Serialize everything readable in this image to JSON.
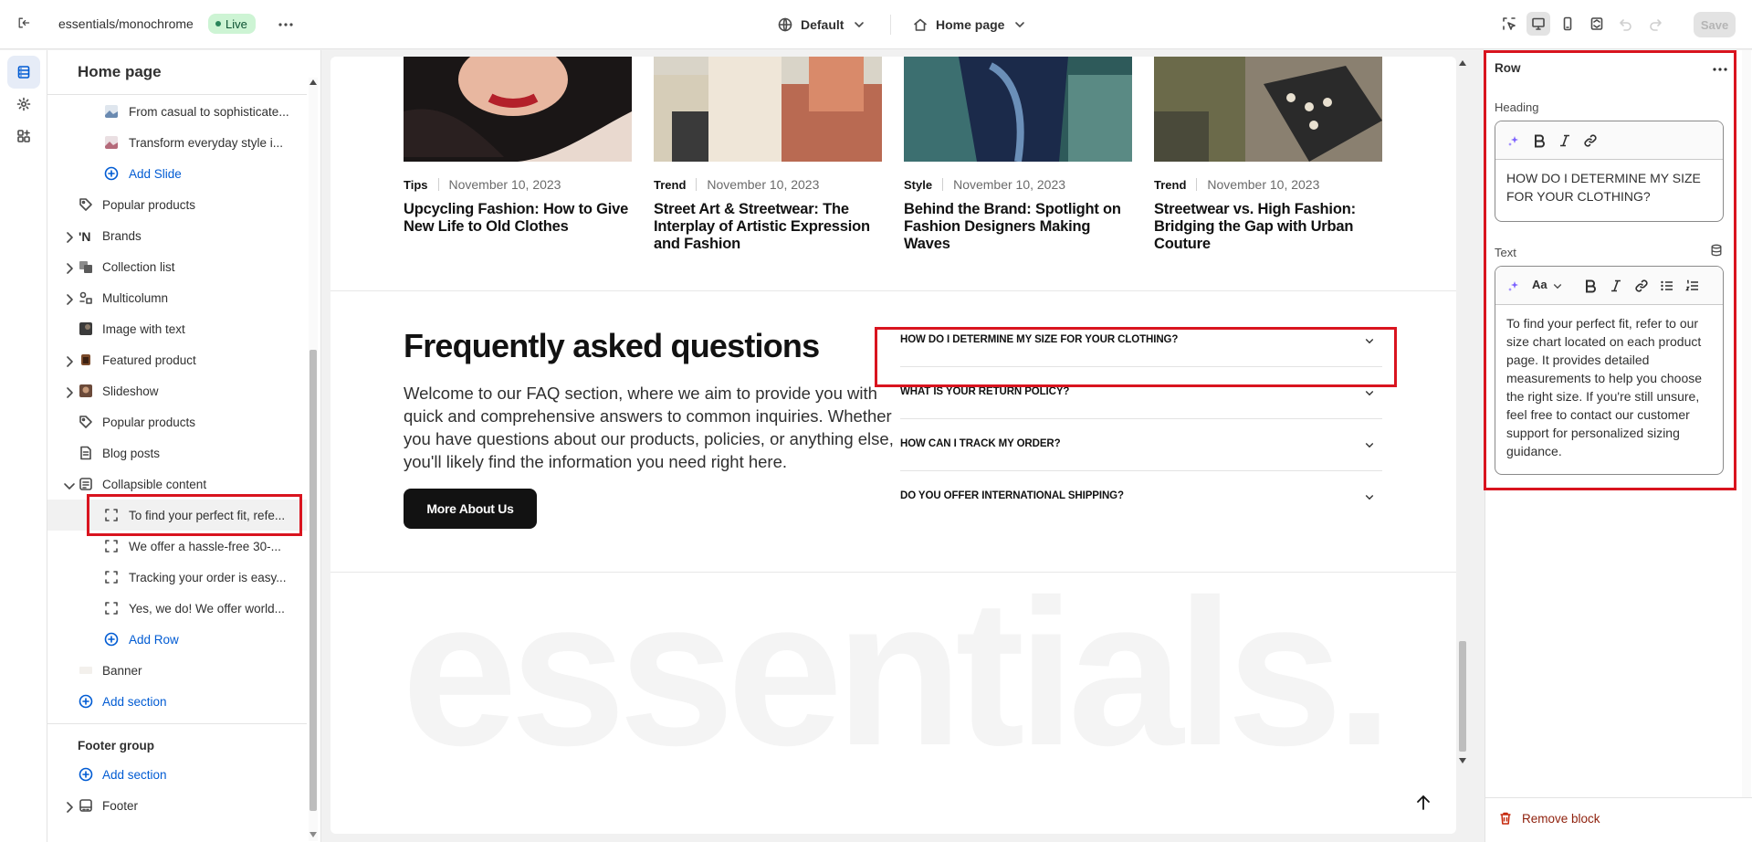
{
  "topbar": {
    "store_name": "essentials/monochrome",
    "status_badge": "Live",
    "theme_selector": "Default",
    "page_selector": "Home page",
    "save_label": "Save"
  },
  "sidebar": {
    "title": "Home page",
    "items": [
      {
        "label": "From casual to sophisticate..."
      },
      {
        "label": "Transform everyday style i..."
      },
      {
        "label": "Add Slide"
      },
      {
        "label": "Popular products"
      },
      {
        "label": "Brands"
      },
      {
        "label": "Collection list"
      },
      {
        "label": "Multicolumn"
      },
      {
        "label": "Image with text"
      },
      {
        "label": "Featured product"
      },
      {
        "label": "Slideshow"
      },
      {
        "label": "Popular products"
      },
      {
        "label": "Blog posts"
      },
      {
        "label": "Collapsible content"
      },
      {
        "label": "To find your perfect fit, refe..."
      },
      {
        "label": "We offer a hassle-free 30-..."
      },
      {
        "label": "Tracking your order is easy..."
      },
      {
        "label": "Yes, we do! We offer world..."
      },
      {
        "label": "Add Row"
      },
      {
        "label": "Banner"
      },
      {
        "label": "Add section"
      }
    ],
    "footer_group_title": "Footer group",
    "footer_add_section": "Add section",
    "footer_item": "Footer"
  },
  "preview": {
    "blog_cards": [
      {
        "tag": "Tips",
        "date": "November 10, 2023",
        "title": "Upcycling Fashion: How to Give New Life to Old Clothes"
      },
      {
        "tag": "Trend",
        "date": "November 10, 2023",
        "title": "Street Art & Streetwear: The Interplay of Artistic Expression and Fashion"
      },
      {
        "tag": "Style",
        "date": "November 10, 2023",
        "title": "Behind the Brand: Spotlight on Fashion Designers Making Waves"
      },
      {
        "tag": "Trend",
        "date": "November 10, 2023",
        "title": "Streetwear vs. High Fashion: Bridging the Gap with Urban Couture"
      }
    ],
    "faq": {
      "title": "Frequently asked questions",
      "description": "Welcome to our FAQ section, where we aim to provide you with quick and comprehensive answers to common inquiries. Whether you have questions about our products, policies, or anything else, you'll likely find the information you need right here.",
      "button": "More About Us",
      "questions": [
        "HOW DO I DETERMINE MY SIZE FOR YOUR CLOTHING?",
        "WHAT IS YOUR RETURN POLICY?",
        "HOW CAN I TRACK MY ORDER?",
        "DO YOU OFFER INTERNATIONAL SHIPPING?"
      ]
    },
    "watermark": "essentials."
  },
  "panel": {
    "title": "Row",
    "heading_label": "Heading",
    "heading_value": "HOW DO I DETERMINE MY SIZE FOR YOUR CLOTHING?",
    "text_label": "Text",
    "text_value": "To find your perfect fit, refer to our size chart located on each product page. It provides detailed measurements to help you choose the right size. If you're still unsure, feel free to contact our customer support for personalized sizing guidance.",
    "format_label": "Aa",
    "remove_label": "Remove block"
  },
  "colors": {
    "accent": "#005bd3",
    "highlight": "#d9141f",
    "live_badge_bg": "#cdf4d4",
    "danger": "#8e1f0b"
  },
  "icons": [
    "exit-icon",
    "more-icon",
    "globe-icon",
    "home-icon",
    "chevron-down-icon",
    "select-icon",
    "desktop-icon",
    "mobile-icon",
    "fullwidth-icon",
    "undo-icon",
    "redo-icon",
    "sections-icon",
    "settings-icon",
    "apps-icon",
    "image-icon",
    "plus-circle-icon",
    "tag-icon",
    "brand-icon",
    "collection-icon",
    "multicolumn-icon",
    "blog-icon",
    "block-icon",
    "ai-icon",
    "bold-icon",
    "italic-icon",
    "link-icon",
    "database-icon",
    "bullet-list-icon",
    "numbered-list-icon",
    "trash-icon",
    "arrow-up-icon"
  ]
}
